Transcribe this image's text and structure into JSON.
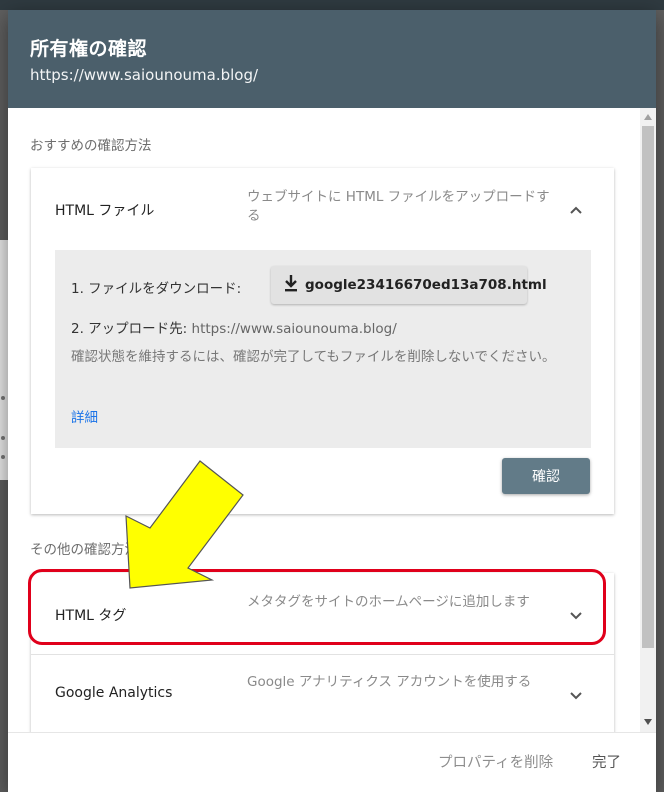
{
  "dialog": {
    "title": "所有権の確認",
    "site_url": "https://www.saiounouma.blog/"
  },
  "recommended_label": "おすすめの確認方法",
  "html_file": {
    "title": "HTML ファイル",
    "description": "ウェブサイトに HTML ファイルをアップロードする",
    "step1_label": "1. ファイルをダウンロード:",
    "download_filename": "google23416670ed13a708.html",
    "step2_label": "2. アップロード先:",
    "step2_url": "https://www.saiounouma.blog/",
    "note": "確認状態を維持するには、確認が完了してもファイルを削除しないでください。",
    "details_link": "詳細",
    "confirm_button": "確認"
  },
  "other_label": "その他の確認方法",
  "other_methods": [
    {
      "title": "HTML タグ",
      "description": "メタタグをサイトのホームページに追加します"
    },
    {
      "title": "Google Analytics",
      "description": "Google アナリティクス アカウントを使用する"
    }
  ],
  "footer": {
    "delete_property": "プロパティを削除",
    "done": "完了"
  },
  "colors": {
    "header_bg": "#4b5f6b",
    "confirm_bg": "#627b88",
    "link": "#1a73e8",
    "highlight": "#e0001b",
    "arrow_fill": "#ffff00"
  },
  "icons": {
    "download": "download-icon",
    "collapse": "chevron-up-icon",
    "expand": "chevron-down-icon"
  }
}
